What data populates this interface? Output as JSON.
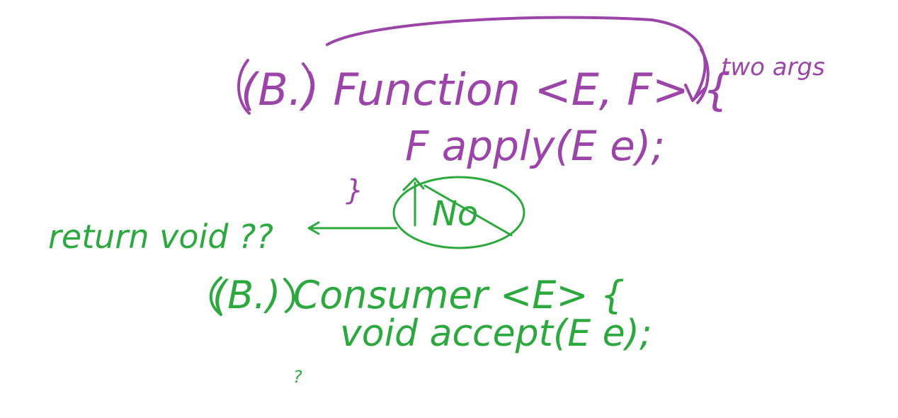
{
  "canvas": {
    "background_color": "#ffffff"
  },
  "colors": {
    "purple_ink": "#9b45a8",
    "green_ink": "#2ca83f"
  },
  "purple_notes": {
    "function_decl": "(B.) Function <E, F> {",
    "apply_line": "F  apply(E e);",
    "closing_brace": "}",
    "two_args": "two args"
  },
  "green_notes": {
    "no_label": "No",
    "return_void": "return void ??",
    "consumer_decl": "(B.) Consumer <E> {",
    "accept_line": "void accept(E e);",
    "stray_mark": "?"
  }
}
